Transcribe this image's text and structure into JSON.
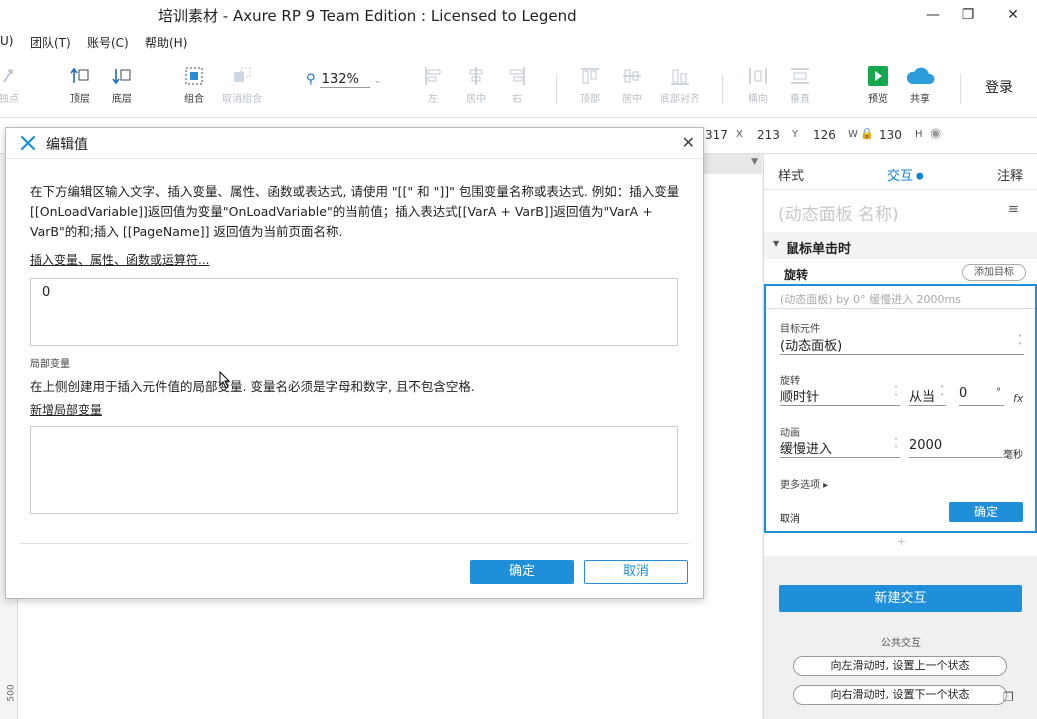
{
  "window": {
    "title": "培训素材 - Axure RP 9 Team Edition : Licensed to Legend"
  },
  "menu": [
    "U)",
    "团队(T)",
    "账号(C)",
    "帮助(H)"
  ],
  "toolbar": {
    "items": [
      {
        "label": "独点",
        "dim": true
      },
      {
        "label": "顶层",
        "dim": false
      },
      {
        "label": "底层",
        "dim": false
      },
      {
        "label": "组合",
        "dim": false
      },
      {
        "label": "取消组合",
        "dim": true
      },
      {
        "label": "左",
        "dim": true
      },
      {
        "label": "居中",
        "dim": true
      },
      {
        "label": "右",
        "dim": true
      },
      {
        "label": "顶部",
        "dim": true
      },
      {
        "label": "居中",
        "dim": true
      },
      {
        "label": "底部对齐",
        "dim": true
      },
      {
        "label": "横向",
        "dim": true
      },
      {
        "label": "垂直",
        "dim": true
      },
      {
        "label": "预览",
        "dim": false
      },
      {
        "label": "共享",
        "dim": false
      }
    ],
    "zoom": "132%",
    "login": "登录"
  },
  "coords": {
    "x": "317",
    "x_label": "X",
    "y": "213",
    "y_label": "Y",
    "w": "126",
    "w_label": "W",
    "h": "130",
    "h_label": "H"
  },
  "ruler": {
    "mark": "500"
  },
  "panel": {
    "tabs": [
      "样式",
      "交互",
      "注释"
    ],
    "widget_name_placeholder": "(动态面板 名称)",
    "event": "鼠标单击时",
    "action": "旋转",
    "add_target": "添加目标",
    "summary": "(动态面板) by 0° 缓慢进入 2000ms",
    "target_label": "目标元件",
    "target_value": "(动态面板)",
    "rotate_label": "旋转",
    "rotate_dir": "顺时针",
    "rotate_from": "从当",
    "rotate_deg": "0",
    "deg_unit": "°",
    "fx": "fx",
    "anim_label": "动画",
    "anim_value": "缓慢进入",
    "anim_ms": "2000",
    "ms_unit": "毫秒",
    "more": "更多选项 ▸",
    "cancel": "取消",
    "ok": "确定",
    "plus": "+",
    "new_interaction": "新建交互",
    "public_label": "公共交互",
    "pill1": "向左滑动时, 设置上一个状态",
    "pill2": "向右滑动时, 设置下一个状态"
  },
  "dialog": {
    "title": "编辑值",
    "description": "在下方编辑区输入文字、插入变量、属性、函数或表达式, 请使用 \"[[\" 和 \"]]\" 包围变量名称或表达式. 例如：插入变量[[OnLoadVariable]]返回值为变量\"OnLoadVariable\"的当前值；插入表达式[[VarA + VarB]]返回值为\"VarA + VarB\"的和;插入 [[PageName]] 返回值为当前页面名称.",
    "insert_link": "插入变量、属性、函数或运算符...",
    "value": "0",
    "local_vars_label": "局部变量",
    "local_hint": "在上侧创建用于插入元件值的局部变量. 变量名必须是字母和数字, 且不包含空格.",
    "add_local": "新增局部变量",
    "ok": "确定",
    "cancel": "取消"
  },
  "colors": {
    "accent": "#1e8fd8",
    "preview_green": "#15a84f",
    "share_blue": "#2d9cdb"
  }
}
